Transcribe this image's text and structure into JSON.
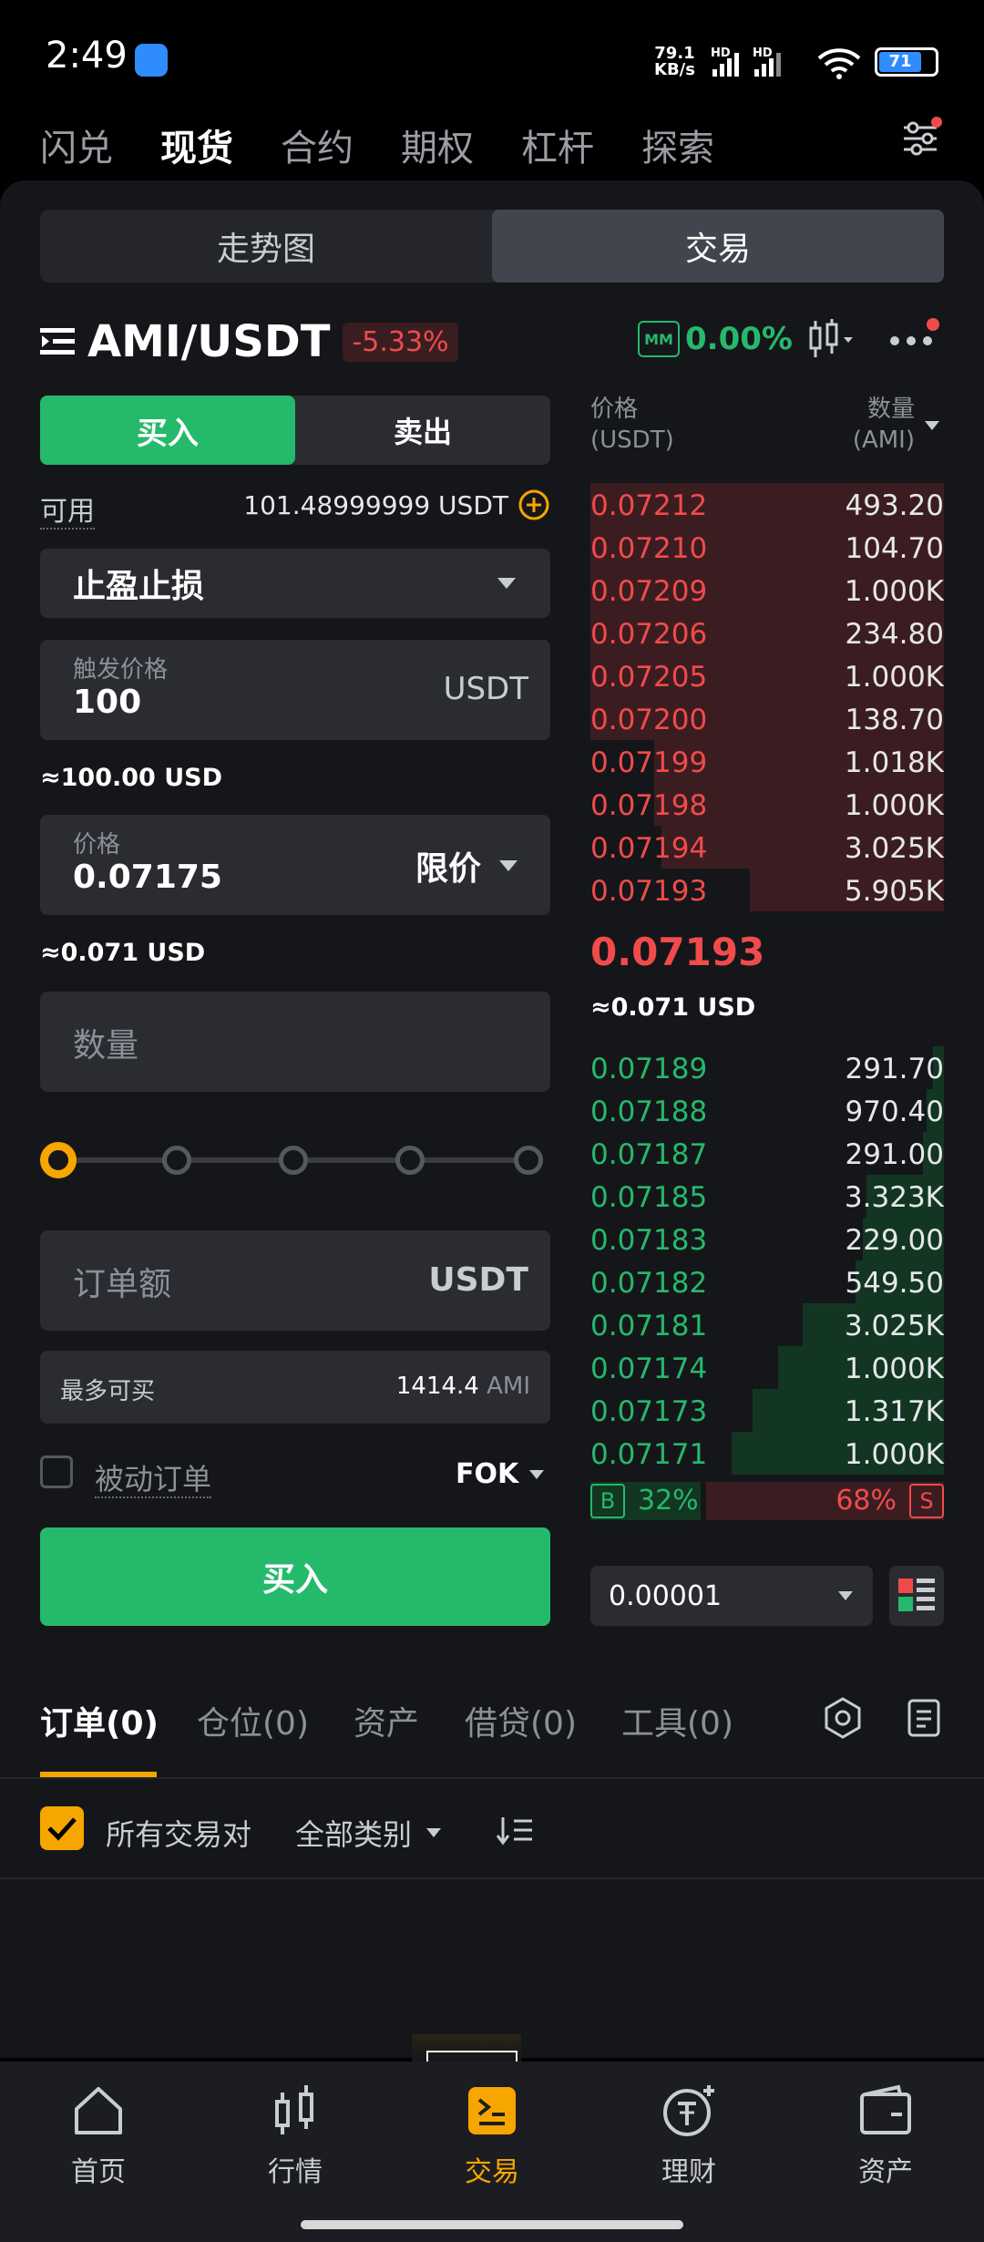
{
  "status_bar": {
    "time": "2:49",
    "net_speed": "79.1",
    "net_unit": "KB/s",
    "battery": "71"
  },
  "top_nav": {
    "items": [
      "闪兑",
      "现货",
      "合约",
      "期权",
      "杠杆",
      "探索"
    ],
    "active": "现货"
  },
  "segment": {
    "chart": "走势图",
    "trade": "交易"
  },
  "pair": {
    "name": "AMI/USDT",
    "change": "-5.33%",
    "mm_label": "MM",
    "mm_value": "0.00%"
  },
  "order_form": {
    "buy_tab": "买入",
    "sell_tab": "卖出",
    "available_label": "可用",
    "available_value": "101.48999999 USDT",
    "order_type": "止盈止损",
    "trigger_label": "触发价格",
    "trigger_value": "100",
    "trigger_unit": "USDT",
    "trigger_usd": "≈100.00 USD",
    "price_label": "价格",
    "price_value": "0.07175",
    "price_mode": "限价",
    "price_usd": "≈0.071 USD",
    "quantity_placeholder": "数量",
    "amount_placeholder": "订单额",
    "amount_unit": "USDT",
    "max_buy_label": "最多可买",
    "max_buy_value": "1414.4",
    "max_buy_unit": "AMI",
    "passive_label": "被动订单",
    "tif": "FOK",
    "submit": "买入"
  },
  "orderbook": {
    "price_header": "价格",
    "price_unit": "(USDT)",
    "qty_header": "数量",
    "qty_unit": "(AMI)",
    "asks": [
      {
        "price": "0.07212",
        "qty": "493.20",
        "depth": 1.0
      },
      {
        "price": "0.07210",
        "qty": "104.70",
        "depth": 1.0
      },
      {
        "price": "0.07209",
        "qty": "1.000K",
        "depth": 1.0
      },
      {
        "price": "0.07206",
        "qty": "234.80",
        "depth": 1.0
      },
      {
        "price": "0.07205",
        "qty": "1.000K",
        "depth": 1.0
      },
      {
        "price": "0.07200",
        "qty": "138.70",
        "depth": 1.0
      },
      {
        "price": "0.07199",
        "qty": "1.018K",
        "depth": 0.82
      },
      {
        "price": "0.07198",
        "qty": "1.000K",
        "depth": 0.82
      },
      {
        "price": "0.07194",
        "qty": "3.025K",
        "depth": 0.8
      },
      {
        "price": "0.07193",
        "qty": "5.905K",
        "depth": 0.55
      }
    ],
    "last_price": "0.07193",
    "last_usd": "≈0.071 USD",
    "bids": [
      {
        "price": "0.07189",
        "qty": "291.70",
        "depth": 0.03
      },
      {
        "price": "0.07188",
        "qty": "970.40",
        "depth": 0.05
      },
      {
        "price": "0.07187",
        "qty": "291.00",
        "depth": 0.06
      },
      {
        "price": "0.07185",
        "qty": "3.323K",
        "depth": 0.22
      },
      {
        "price": "0.07183",
        "qty": "229.00",
        "depth": 0.23
      },
      {
        "price": "0.07182",
        "qty": "549.50",
        "depth": 0.25
      },
      {
        "price": "0.07181",
        "qty": "3.025K",
        "depth": 0.4
      },
      {
        "price": "0.07174",
        "qty": "1.000K",
        "depth": 0.47
      },
      {
        "price": "0.07173",
        "qty": "1.317K",
        "depth": 0.54
      },
      {
        "price": "0.07171",
        "qty": "1.000K",
        "depth": 0.6
      }
    ],
    "buy_ratio": "32%",
    "sell_ratio": "68%",
    "buy_ratio_value": 0.32,
    "b_label": "B",
    "s_label": "S",
    "precision": "0.00001"
  },
  "bottom_tabs": {
    "items": [
      "订单(0)",
      "仓位(0)",
      "资产",
      "借贷(0)",
      "工具(0)"
    ]
  },
  "filters": {
    "all_pairs": "所有交易对",
    "all_types": "全部类别"
  },
  "bottom_nav": {
    "items": [
      "首页",
      "行情",
      "交易",
      "理财",
      "资产"
    ],
    "active": "交易"
  },
  "colors": {
    "green": "#25b96c",
    "red": "#f04b4b",
    "accent": "#f7a600"
  }
}
